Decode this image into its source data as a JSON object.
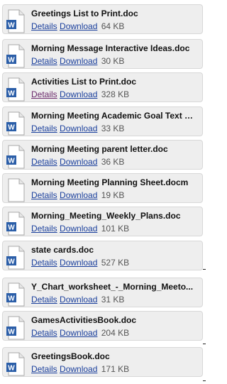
{
  "links": {
    "details": "Details",
    "download": "Download"
  },
  "files": [
    {
      "name": "Greetings List to Print.doc",
      "size": "64 KB",
      "icon": "word-doc-icon"
    },
    {
      "name": "Morning Message Interactive Ideas.doc",
      "size": "30 KB",
      "icon": "word-doc-icon"
    },
    {
      "name": "Activities List to Print.doc",
      "size": "328 KB",
      "icon": "word-doc-icon"
    },
    {
      "name": "Morning Meeting Academic Goal Text St...",
      "size": "33 KB",
      "icon": "word-doc-icon"
    },
    {
      "name": "Morning Meeting parent letter.doc",
      "size": "36 KB",
      "icon": "word-doc-icon"
    },
    {
      "name": "Morning Meeting Planning Sheet.docm",
      "size": "19 KB",
      "icon": "blank-document-icon"
    },
    {
      "name": "Morning_Meeting_Weekly_Plans.doc",
      "size": "101 KB",
      "icon": "word-doc-icon"
    },
    {
      "name": "state cards.doc",
      "size": "527 KB",
      "icon": "word-doc-icon"
    },
    {
      "name": "Y_Chart_worksheet_-_Morning_Meeto...",
      "size": "31 KB",
      "icon": "word-doc-icon"
    },
    {
      "name": "GamesActivitiesBook.doc",
      "size": "204 KB",
      "icon": "word-doc-icon"
    },
    {
      "name": "GreetingsBook.doc",
      "size": "171 KB",
      "icon": "word-doc-icon"
    }
  ],
  "colors": {
    "link": "#1a3f9c",
    "visited_link": "#6b2a6b",
    "card_background": "#eeeeee",
    "word_blue": "#2b5ea8"
  }
}
